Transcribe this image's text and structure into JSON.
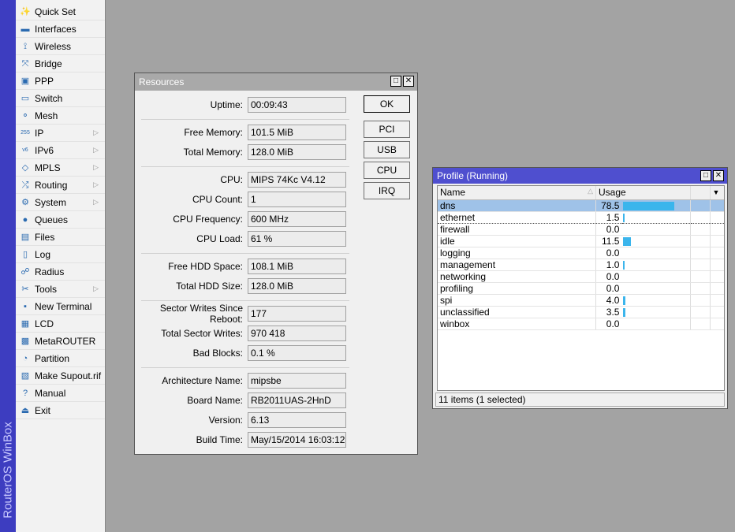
{
  "brand": "RouterOS WinBox",
  "menu": [
    {
      "label": "Quick Set",
      "icon": "wand-icon",
      "sub": false
    },
    {
      "label": "Interfaces",
      "icon": "network-card-icon",
      "sub": false
    },
    {
      "label": "Wireless",
      "icon": "antenna-icon",
      "sub": false
    },
    {
      "label": "Bridge",
      "icon": "bridge-icon",
      "sub": false
    },
    {
      "label": "PPP",
      "icon": "ppp-icon",
      "sub": false
    },
    {
      "label": "Switch",
      "icon": "switch-icon",
      "sub": false
    },
    {
      "label": "Mesh",
      "icon": "mesh-icon",
      "sub": false
    },
    {
      "label": "IP",
      "icon": "ip-icon",
      "sub": true
    },
    {
      "label": "IPv6",
      "icon": "ipv6-icon",
      "sub": true
    },
    {
      "label": "MPLS",
      "icon": "mpls-icon",
      "sub": true
    },
    {
      "label": "Routing",
      "icon": "routing-icon",
      "sub": true
    },
    {
      "label": "System",
      "icon": "gear-icon",
      "sub": true
    },
    {
      "label": "Queues",
      "icon": "queues-icon",
      "sub": false
    },
    {
      "label": "Files",
      "icon": "folder-icon",
      "sub": false
    },
    {
      "label": "Log",
      "icon": "log-icon",
      "sub": false
    },
    {
      "label": "Radius",
      "icon": "radius-icon",
      "sub": false
    },
    {
      "label": "Tools",
      "icon": "tools-icon",
      "sub": true
    },
    {
      "label": "New Terminal",
      "icon": "terminal-icon",
      "sub": false
    },
    {
      "label": "LCD",
      "icon": "lcd-icon",
      "sub": false
    },
    {
      "label": "MetaROUTER",
      "icon": "metarouter-icon",
      "sub": false
    },
    {
      "label": "Partition",
      "icon": "partition-icon",
      "sub": false
    },
    {
      "label": "Make Supout.rif",
      "icon": "supout-icon",
      "sub": false
    },
    {
      "label": "Manual",
      "icon": "help-icon",
      "sub": false
    },
    {
      "label": "Exit",
      "icon": "exit-icon",
      "sub": false
    }
  ],
  "resources": {
    "title": "Resources",
    "fields": [
      {
        "label": "Uptime:",
        "value": "00:09:43"
      },
      {
        "label": "Free Memory:",
        "value": "101.5 MiB"
      },
      {
        "label": "Total Memory:",
        "value": "128.0 MiB"
      },
      {
        "label": "CPU:",
        "value": "MIPS 74Kc V4.12"
      },
      {
        "label": "CPU Count:",
        "value": "1"
      },
      {
        "label": "CPU Frequency:",
        "value": "600 MHz"
      },
      {
        "label": "CPU Load:",
        "value": "61 %"
      },
      {
        "label": "Free HDD Space:",
        "value": "108.1 MiB"
      },
      {
        "label": "Total HDD Size:",
        "value": "128.0 MiB"
      },
      {
        "label": "Sector Writes Since Reboot:",
        "value": "177"
      },
      {
        "label": "Total Sector Writes:",
        "value": "970 418"
      },
      {
        "label": "Bad Blocks:",
        "value": "0.1 %"
      },
      {
        "label": "Architecture Name:",
        "value": "mipsbe"
      },
      {
        "label": "Board Name:",
        "value": "RB2011UAS-2HnD"
      },
      {
        "label": "Version:",
        "value": "6.13"
      },
      {
        "label": "Build Time:",
        "value": "May/15/2014 16:03:12"
      }
    ],
    "buttons": [
      "OK",
      "PCI",
      "USB",
      "CPU",
      "IRQ"
    ]
  },
  "profile": {
    "title": "Profile (Running)",
    "columns": [
      "Name",
      "Usage"
    ],
    "rows": [
      {
        "name": "dns",
        "usage": "78.5",
        "pct": 78.5
      },
      {
        "name": "ethernet",
        "usage": "1.5",
        "pct": 1.5
      },
      {
        "name": "firewall",
        "usage": "0.0",
        "pct": 0
      },
      {
        "name": "idle",
        "usage": "11.5",
        "pct": 11.5
      },
      {
        "name": "logging",
        "usage": "0.0",
        "pct": 0
      },
      {
        "name": "management",
        "usage": "1.0",
        "pct": 1.0
      },
      {
        "name": "networking",
        "usage": "0.0",
        "pct": 0
      },
      {
        "name": "profiling",
        "usage": "0.0",
        "pct": 0
      },
      {
        "name": "spi",
        "usage": "4.0",
        "pct": 4.0
      },
      {
        "name": "unclassified",
        "usage": "3.5",
        "pct": 3.5
      },
      {
        "name": "winbox",
        "usage": "0.0",
        "pct": 0
      }
    ],
    "selected": 0,
    "status": "11 items (1 selected)",
    "bar_color": "#3bb5ec"
  }
}
